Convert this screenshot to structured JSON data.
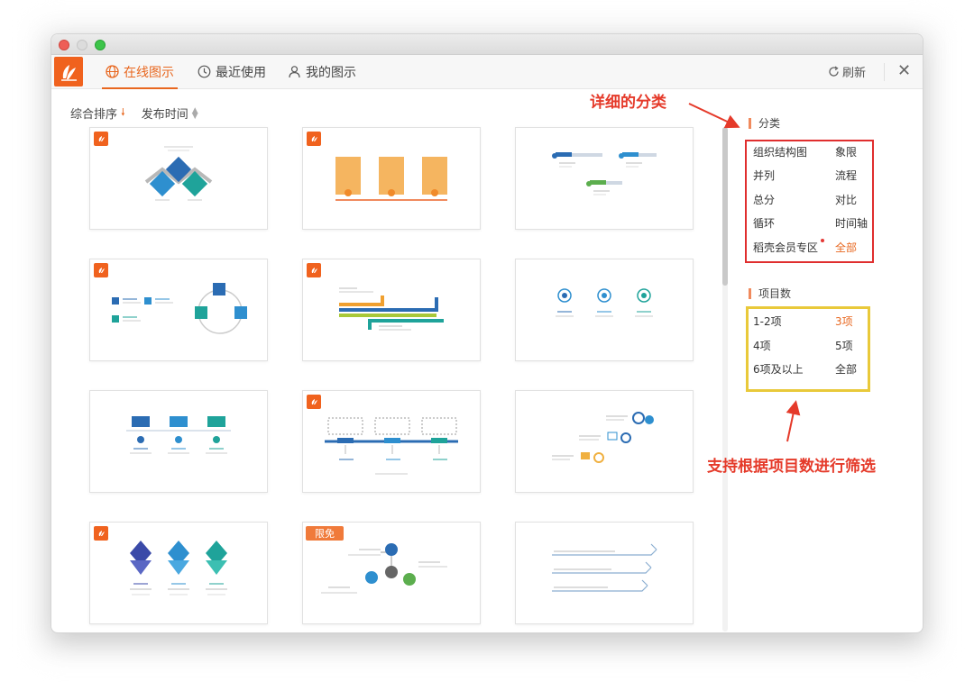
{
  "tabs": [
    {
      "label": "在线图示",
      "icon": "globe-icon",
      "active": true
    },
    {
      "label": "最近使用",
      "icon": "clock-icon",
      "active": false
    },
    {
      "label": "我的图示",
      "icon": "user-icon",
      "active": false
    }
  ],
  "refresh_label": "刷新",
  "sort": {
    "primary": "综合排序",
    "secondary": "发布时间"
  },
  "sidebar": {
    "category_title": "分类",
    "categories": [
      {
        "label": "组织结构图",
        "active": false
      },
      {
        "label": "象限",
        "active": false
      },
      {
        "label": "并列",
        "active": false
      },
      {
        "label": "流程",
        "active": false
      },
      {
        "label": "总分",
        "active": false
      },
      {
        "label": "对比",
        "active": false
      },
      {
        "label": "循环",
        "active": false
      },
      {
        "label": "时间轴",
        "active": false
      },
      {
        "label": "稻壳会员专区",
        "active": false,
        "dot": true
      },
      {
        "label": "全部",
        "active": true
      }
    ],
    "count_title": "项目数",
    "counts": [
      {
        "label": "1-2项",
        "active": false
      },
      {
        "label": "3项",
        "active": true
      },
      {
        "label": "4项",
        "active": false
      },
      {
        "label": "5项",
        "active": false
      },
      {
        "label": "6项及以上",
        "active": false
      },
      {
        "label": "全部",
        "active": false
      }
    ]
  },
  "templates": [
    {
      "badge": "logo"
    },
    {
      "badge": "logo"
    },
    {
      "badge": "logo"
    },
    {
      "badge": "logo"
    },
    {
      "badge": "logo"
    },
    {
      "badge": "logo"
    },
    {
      "badge": "none"
    },
    {
      "badge": "logo"
    },
    {
      "badge": "none"
    },
    {
      "badge": "logo"
    },
    {
      "badge": "free",
      "badge_label": "限免"
    },
    {
      "badge": "none"
    }
  ],
  "annotations": {
    "category_note": "详细的分类",
    "count_note": "支持根据项目数进行筛选"
  },
  "colors": {
    "accent": "#e8671f",
    "logo": "#f0621e",
    "annotation_red": "#e53a2a",
    "highlight_yellow": "#e9c93a"
  }
}
